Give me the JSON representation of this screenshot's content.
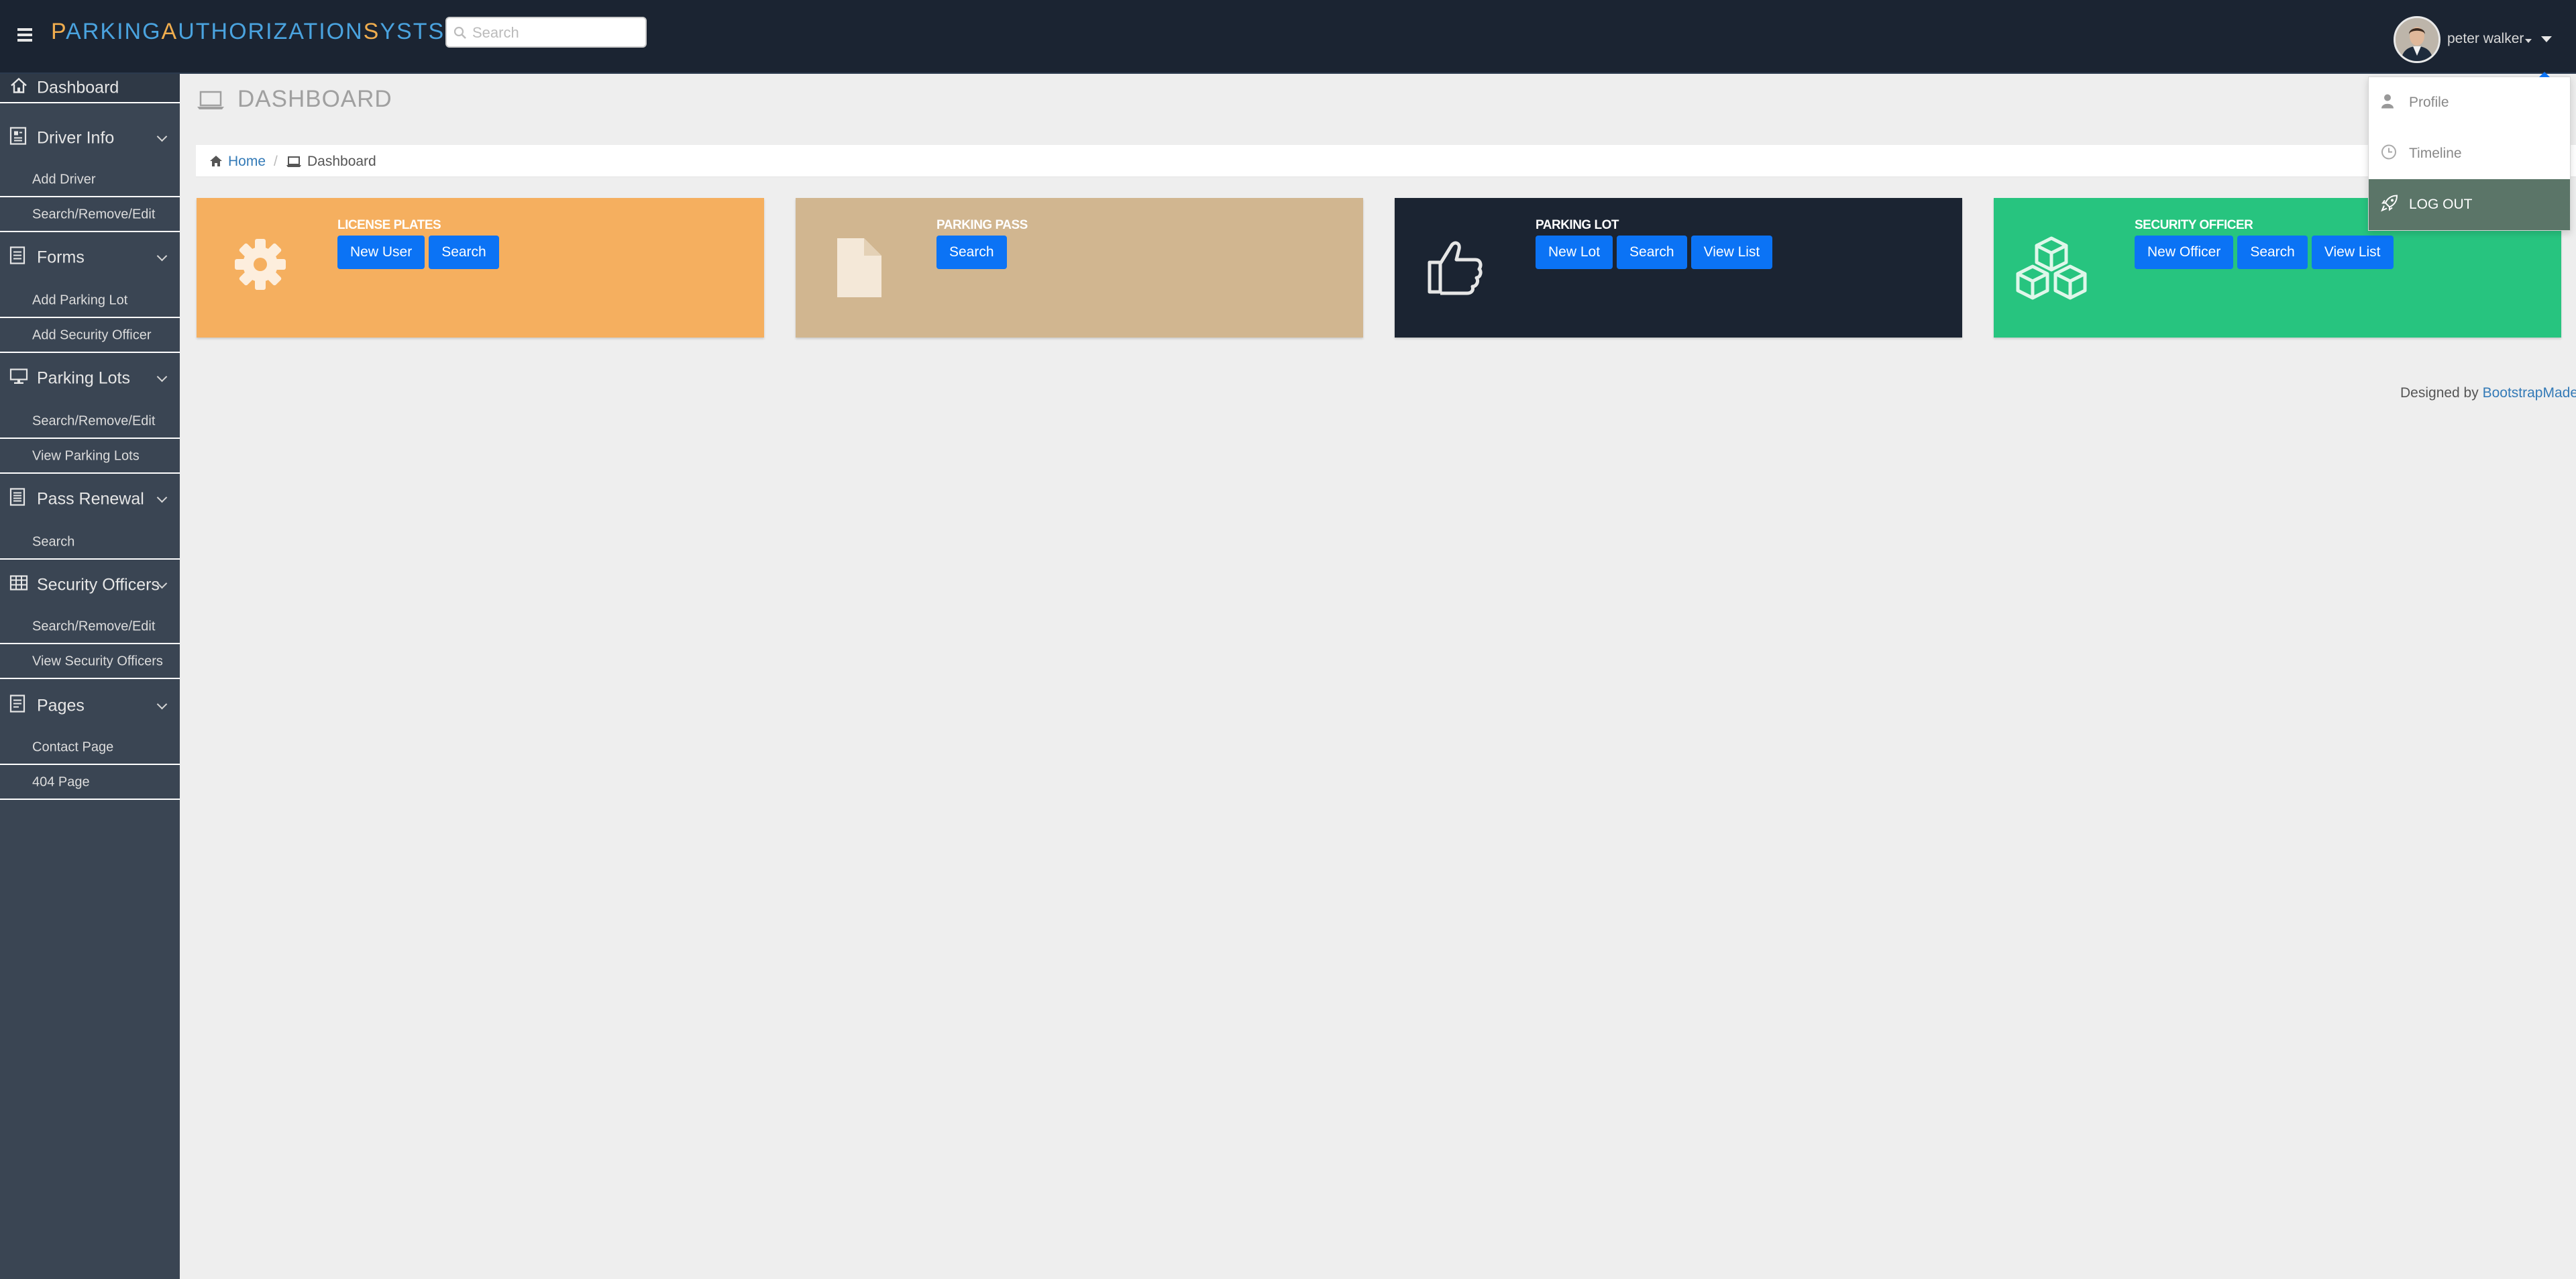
{
  "header": {
    "brand": [
      {
        "cap": "P",
        "rest": "ARKING"
      },
      {
        "cap": "A",
        "rest": "UTHORIZATION"
      },
      {
        "cap": "S",
        "rest": "YSTSEM"
      }
    ],
    "search_placeholder": "Search",
    "user_name": "peter walker"
  },
  "user_menu": {
    "items": [
      {
        "label": "Profile",
        "icon": "user-icon"
      },
      {
        "label": "Timeline",
        "icon": "clock-icon"
      },
      {
        "label": "LOG OUT",
        "icon": "rocket-icon"
      }
    ]
  },
  "sidebar": {
    "dashboard": {
      "label": "Dashboard",
      "icon": "home-icon"
    },
    "groups": [
      {
        "label": "Driver Info",
        "icon": "address-book-icon",
        "items": [
          "Add Driver",
          "Search/Remove/Edit"
        ]
      },
      {
        "label": "Forms",
        "icon": "document-icon",
        "items": [
          "Add Parking Lot",
          "Add Security Officer"
        ]
      },
      {
        "label": "Parking Lots",
        "icon": "monitor-icon",
        "items": [
          "Search/Remove/Edit",
          "View Parking Lots"
        ]
      },
      {
        "label": "Pass Renewal",
        "icon": "list-icon",
        "items": [
          "Search"
        ]
      },
      {
        "label": "Security Officers",
        "icon": "table-icon",
        "items": [
          "Search/Remove/Edit",
          "View Security Officers"
        ]
      },
      {
        "label": "Pages",
        "icon": "pages-icon",
        "items": [
          "Contact Page",
          "404 Page"
        ]
      }
    ]
  },
  "main": {
    "page_title": "DASHBOARD",
    "breadcrumb": {
      "home": "Home",
      "separator": "/",
      "current": "Dashboard"
    },
    "cards": [
      {
        "title": "LICENSE PLATES",
        "icon": "gear-icon",
        "color": "#f5af5f",
        "buttons": [
          "New User",
          "Search"
        ]
      },
      {
        "title": "PARKING PASS",
        "icon": "file-icon",
        "color": "#d1b690",
        "buttons": [
          "Search"
        ]
      },
      {
        "title": "PARKING LOT",
        "icon": "thumbs-up-icon",
        "color": "#1b2432",
        "buttons": [
          "New Lot",
          "Search",
          "View List"
        ]
      },
      {
        "title": "SECURITY OFFICER",
        "icon": "cubes-icon",
        "color": "#27c47f",
        "buttons": [
          "New Officer",
          "Search",
          "View List"
        ]
      }
    ]
  },
  "footer": {
    "designed_by": "Designed by",
    "link": "BootstrapMade"
  },
  "colors": {
    "topbar": "#1b2432",
    "sidebar": "#3a4553",
    "accent_blue": "#0b73f5",
    "brand_blue": "#4aa3df",
    "brand_orange": "#f0ad4e",
    "logout_bg": "#5b7568"
  }
}
